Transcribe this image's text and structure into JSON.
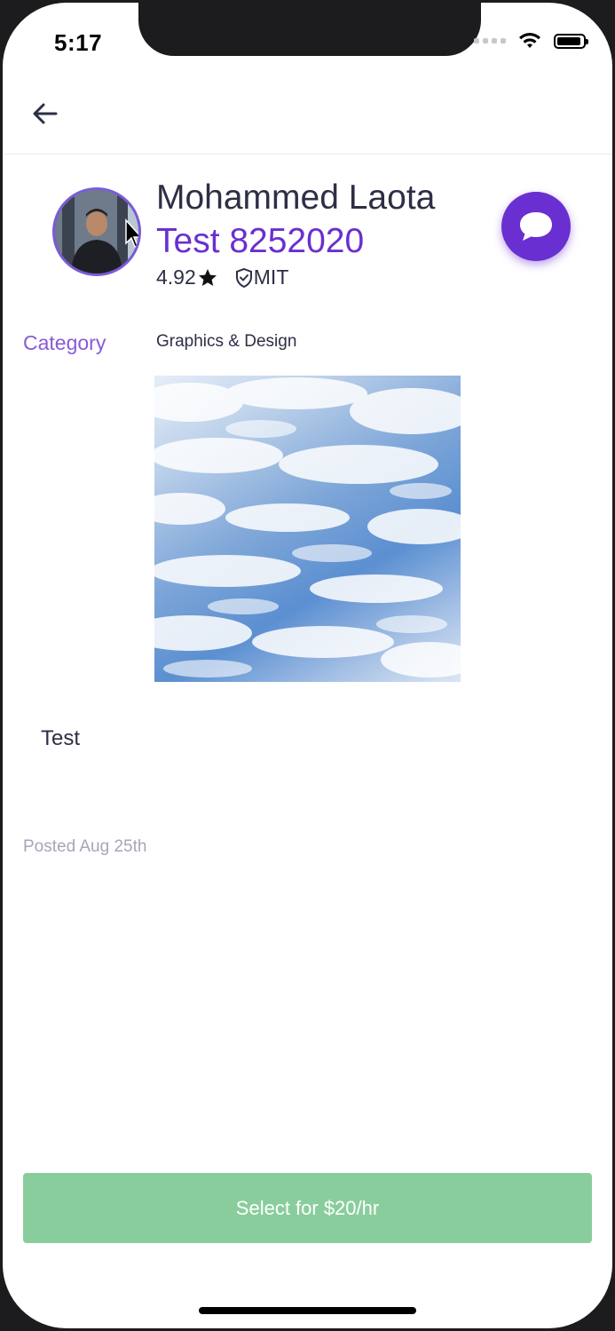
{
  "status_bar": {
    "time": "5:17"
  },
  "profile": {
    "name": "Mohammed Laota",
    "job_title": "Test 8252020",
    "rating": "4.92",
    "school": "MIT"
  },
  "details": {
    "category_label": "Category",
    "category_value": "Graphics & Design",
    "description": "Test",
    "posted": "Posted Aug 25th"
  },
  "actions": {
    "select_label": "Select for $20/hr"
  },
  "colors": {
    "accent": "#6a2fd0",
    "category_label": "#8a5ad6",
    "select_button": "#8acd9c",
    "text_primary": "#2d2f45",
    "text_muted": "#a3a7b8"
  },
  "icons": {
    "back": "arrow-left-icon",
    "chat": "chat-bubble-icon",
    "star": "star-icon",
    "shield": "shield-check-icon",
    "wifi": "wifi-icon",
    "battery": "battery-icon",
    "signal": "signal-icon"
  }
}
